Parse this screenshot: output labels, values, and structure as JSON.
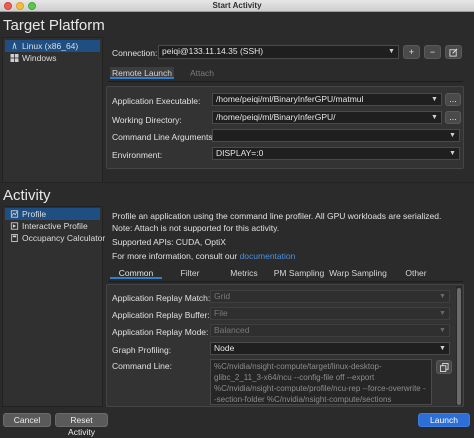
{
  "window": {
    "title": "Start Activity"
  },
  "target_platform": {
    "heading": "Target Platform",
    "platforms": [
      {
        "label": "Linux (x86_64)",
        "icon": "linux-icon",
        "selected": true
      },
      {
        "label": "Windows",
        "icon": "windows-icon",
        "selected": false
      }
    ],
    "connection_label": "Connection:",
    "connection_value": "peiqi@133.11.14.35 (SSH)",
    "tabs": [
      {
        "label": "Remote Launch",
        "active": true
      },
      {
        "label": "Attach",
        "active": false
      }
    ],
    "fields": {
      "app_exe_label": "Application Executable:",
      "app_exe_value": "/home/peiqi/ml/BinaryInferGPU/matmul",
      "workdir_label": "Working Directory:",
      "workdir_value": "/home/peiqi/ml/BinaryInferGPU/",
      "args_label": "Command Line Arguments:",
      "args_value": "",
      "env_label": "Environment:",
      "env_value": "DISPLAY=:0"
    },
    "browse_label": "..."
  },
  "activity": {
    "heading": "Activity",
    "items": [
      {
        "label": "Profile",
        "icon": "profile-icon",
        "selected": true
      },
      {
        "label": "Interactive Profile",
        "icon": "interactive-profile-icon",
        "selected": false
      },
      {
        "label": "Occupancy Calculator",
        "icon": "calculator-icon",
        "selected": false
      }
    ],
    "description": "Profile an application using the command line profiler. All GPU workloads are serialized. Note: Attach is not supported for this activity.",
    "supported_apis": "Supported APIs: CUDA, OptiX",
    "more_info_prefix": "For more information, consult our",
    "more_info_link": "documentation",
    "tabs": [
      {
        "label": "Common",
        "active": true
      },
      {
        "label": "Filter",
        "active": false
      },
      {
        "label": "Metrics",
        "active": false
      },
      {
        "label": "PM Sampling",
        "active": false
      },
      {
        "label": "Warp Sampling",
        "active": false
      },
      {
        "label": "Other",
        "active": false
      }
    ],
    "options": {
      "replay_match_label": "Application Replay Match:",
      "replay_match_value": "Grid",
      "replay_buffer_label": "Application Replay Buffer:",
      "replay_buffer_value": "File",
      "replay_mode_label": "Application Replay Mode:",
      "replay_mode_value": "Balanced",
      "graph_profiling_label": "Graph Profiling:",
      "graph_profiling_value": "Node",
      "command_line_label": "Command Line:",
      "command_line_value": "%C/nvidia/nsight-compute/target/linux-desktop-glibc_2_11_3-x64/ncu --config-file off --export %C/nvidia/nsight-compute/profile/ncu-rep --force-overwrite --section-folder %C/nvidia/nsight-compute/sections /home/peiqi/"
    }
  },
  "footer": {
    "cancel_label": "Cancel",
    "reset_label": "Reset Activity",
    "launch_label": "Launch"
  },
  "colors": {
    "accent": "#2d7dd2",
    "launch": "#2d6fd6",
    "link": "#4a90e2"
  }
}
